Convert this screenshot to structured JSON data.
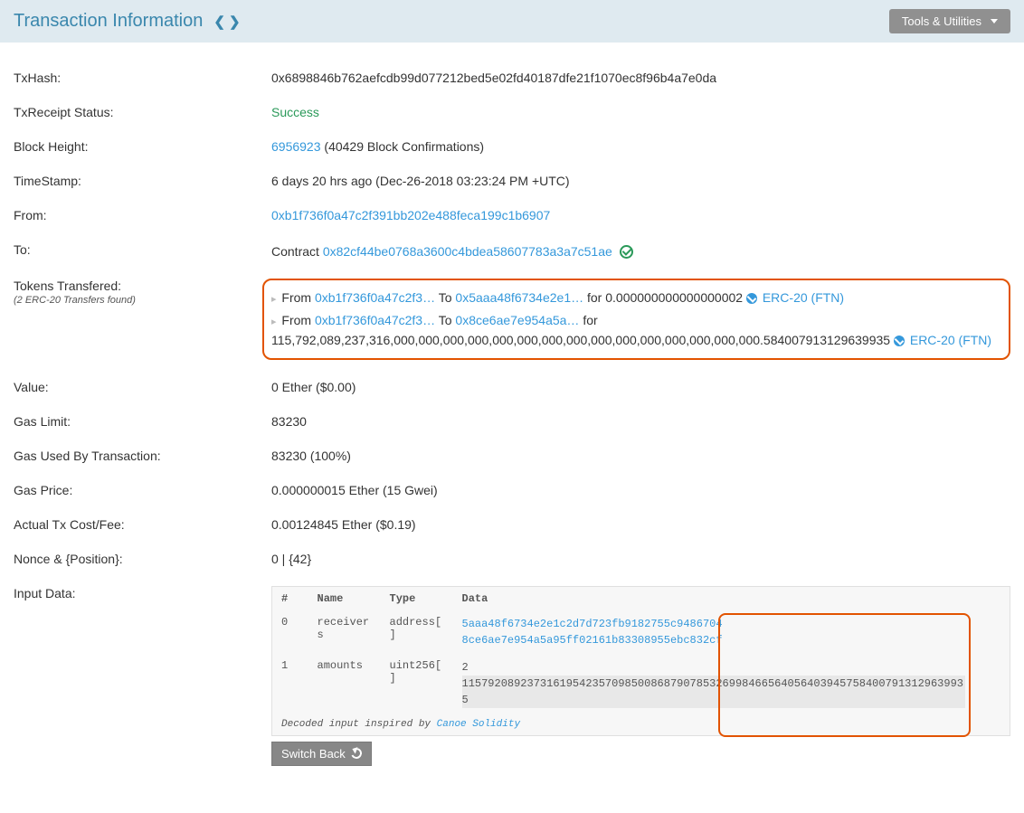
{
  "header": {
    "title": "Transaction Information",
    "tools_label": "Tools & Utilities"
  },
  "labels": {
    "txhash": "TxHash:",
    "receipt": "TxReceipt Status:",
    "block": "Block Height:",
    "timestamp": "TimeStamp:",
    "from": "From:",
    "to": "To:",
    "tokens": "Tokens Transfered:",
    "tokens_sub": "(2 ERC-20 Transfers found)",
    "value": "Value:",
    "gaslimit": "Gas Limit:",
    "gasused": "Gas Used By Transaction:",
    "gasprice": "Gas Price:",
    "cost": "Actual Tx Cost/Fee:",
    "nonce": "Nonce & {Position}:",
    "inputdata": "Input Data:"
  },
  "values": {
    "txhash": "0x6898846b762aefcdb99d077212bed5e02fd40187dfe21f1070ec8f96b4a7e0da",
    "receipt_status": "Success",
    "block_num": "6956923",
    "block_conf": " (40429 Block Confirmations)",
    "timestamp": "6 days 20 hrs ago (Dec-26-2018 03:23:24 PM +UTC)",
    "from_addr": "0xb1f736f0a47c2f391bb202e488feca199c1b6907",
    "to_prefix": "Contract ",
    "to_addr": "0x82cf44be0768a3600c4bdea58607783a3a7c51ae",
    "value": "0 Ether ($0.00)",
    "gaslimit": "83230",
    "gasused": "83230 (100%)",
    "gasprice": "0.000000015 Ether (15 Gwei)",
    "cost": "0.00124845 Ether ($0.19)",
    "nonce": "0 | {42}"
  },
  "transfers": {
    "t1_from_label": "From ",
    "t1_from": "0xb1f736f0a47c2f3…",
    "t1_to_label": "  To ",
    "t1_to": "0x5aaa48f6734e2e1…",
    "t1_for": "for  0.000000000000000002 ",
    "t2_from_label": "From ",
    "t2_from": "0xb1f736f0a47c2f3…",
    "t2_to_label": "  To ",
    "t2_to": "0x8ce6ae7e954a5a…",
    "t2_for": "  for",
    "num2": "115,792,089,237,316,000,000,000,000,000,000,000,000,000,000,000,000,000,000,000.584007913129639935 ",
    "erc20": "ERC-20 (FTN)"
  },
  "input": {
    "col_hash": "#",
    "col_name": "Name",
    "col_type": "Type",
    "col_data": "Data",
    "r0_idx": "0",
    "r0_name": "receivers",
    "r0_type": "address[]",
    "r0_d1": "5aaa48f6734e2e1c2d7d723fb9182755c9486704",
    "r0_d2": "8ce6ae7e954a5a95ff02161b83308955ebc832cf",
    "r1_idx": "1",
    "r1_name": "amounts",
    "r1_type": "uint256[]",
    "r1_d1": "2",
    "r1_d2": "115792089237316195423570985008687907853269984665640564039457584007913129639935",
    "footer_prefix": "Decoded input inspired by ",
    "footer_link": "Canoe Solidity"
  },
  "buttons": {
    "switchback": "Switch Back"
  }
}
